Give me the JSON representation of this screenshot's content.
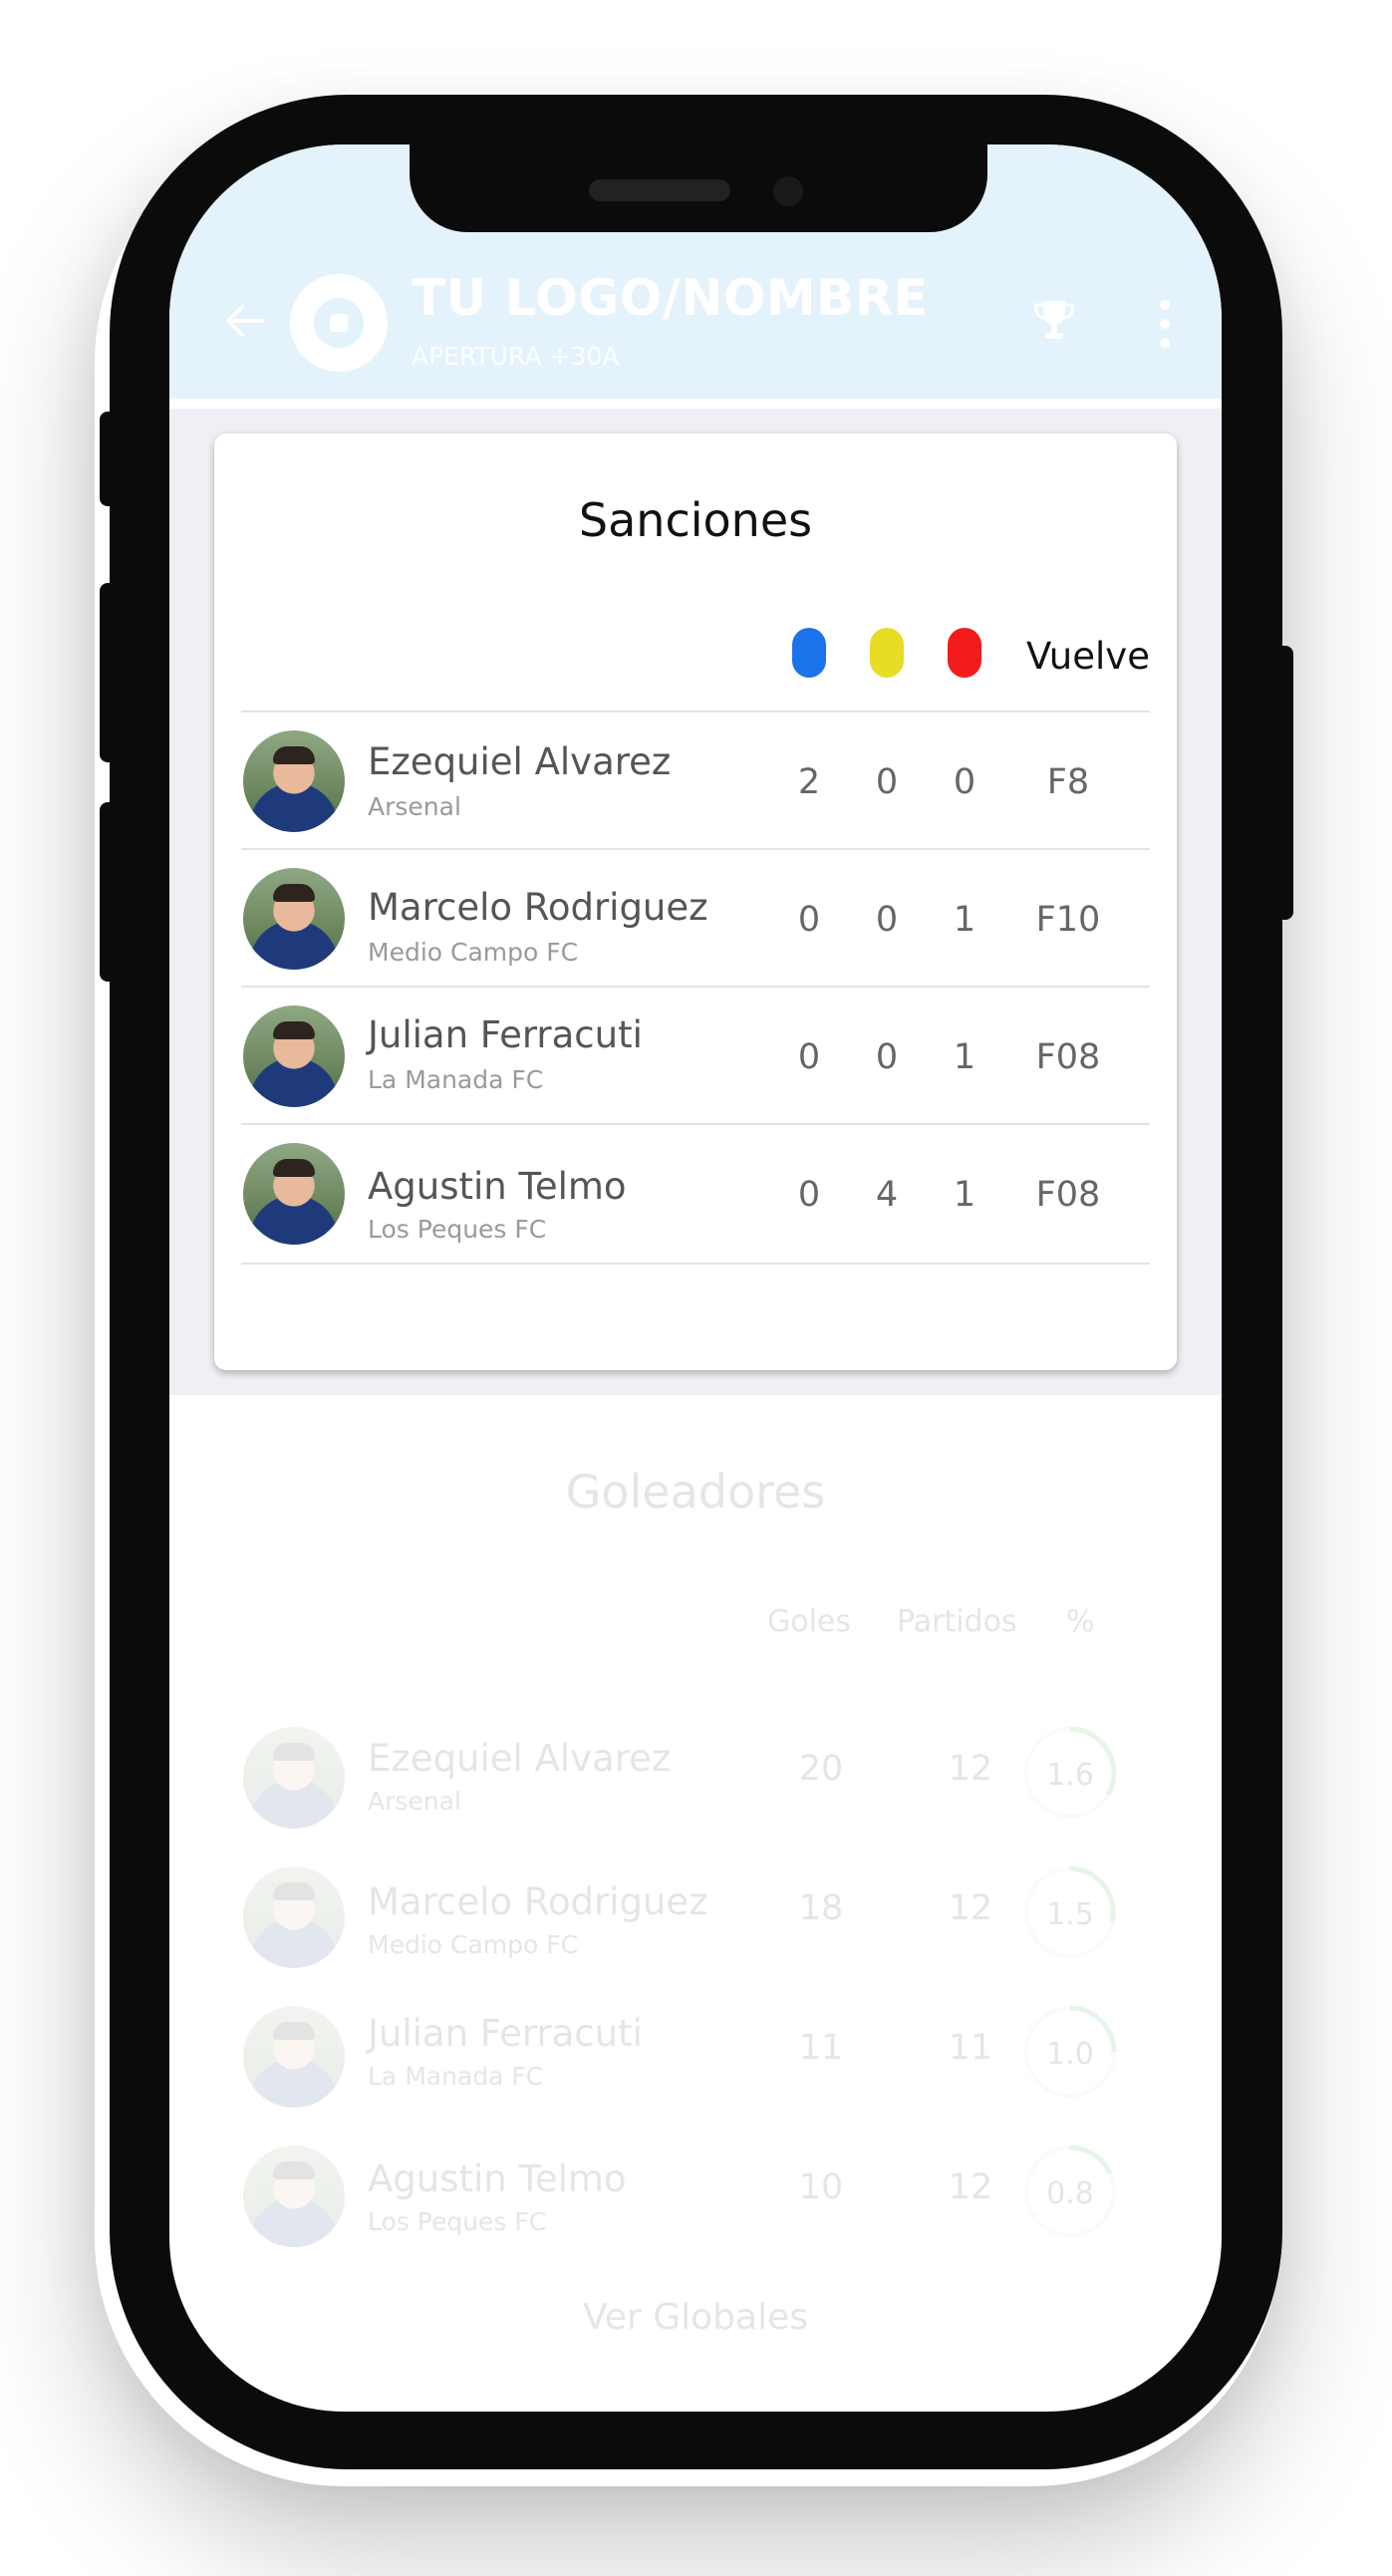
{
  "header": {
    "title": "TU LOGO/NOMBRE",
    "subtitle": "APERTURA +30A"
  },
  "sanciones": {
    "title": "Sanciones",
    "colors": {
      "blue": "#1a73e8",
      "yellow": "#e8dc25",
      "red": "#f21c1c"
    },
    "vuelve_label": "Vuelve",
    "rows": [
      {
        "name": "Ezequiel Alvarez",
        "team": "Arsenal",
        "blue": "2",
        "yellow": "0",
        "red": "0",
        "vuelve": "F8"
      },
      {
        "name": "Marcelo Rodriguez",
        "team": "Medio Campo FC",
        "blue": "0",
        "yellow": "0",
        "red": "1",
        "vuelve": "F10"
      },
      {
        "name": "Julian Ferracuti",
        "team": "La Manada FC",
        "blue": "0",
        "yellow": "0",
        "red": "1",
        "vuelve": "F08"
      },
      {
        "name": "Agustin Telmo",
        "team": "Los Peques FC",
        "blue": "0",
        "yellow": "4",
        "red": "1",
        "vuelve": "F08"
      }
    ]
  },
  "goleadores": {
    "title": "Goleadores",
    "col_goles": "Goles",
    "col_partidos": "Partidos",
    "col_pct": "%",
    "rows": [
      {
        "name": "Ezequiel Alvarez",
        "team": "Arsenal",
        "goles": "20",
        "partidos": "12",
        "pct": "1.6"
      },
      {
        "name": "Marcelo Rodriguez",
        "team": "Medio Campo FC",
        "goles": "18",
        "partidos": "12",
        "pct": "1.5"
      },
      {
        "name": "Julian Ferracuti",
        "team": "La Manada FC",
        "goles": "11",
        "partidos": "11",
        "pct": "1.0"
      },
      {
        "name": "Agustin Telmo",
        "team": "Los Peques FC",
        "goles": "10",
        "partidos": "12",
        "pct": "0.8"
      }
    ],
    "ver_globales": "Ver Globales"
  }
}
